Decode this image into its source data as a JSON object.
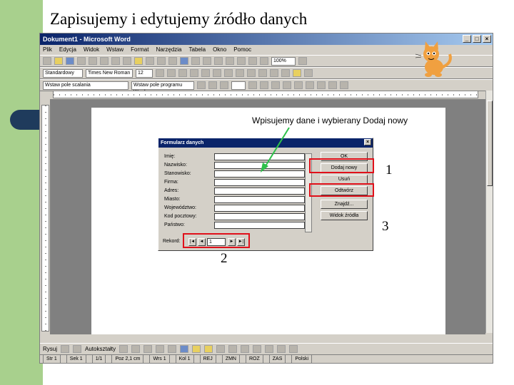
{
  "slide": {
    "title": "Zapisujemy i edytujemy źródło danych",
    "annotation": "Wpisujemy dane i wybierany Dodaj nowy",
    "markers": [
      "1",
      "2",
      "3"
    ]
  },
  "word": {
    "window_title": "Dokument1 - Microsoft Word",
    "menu": [
      "Plik",
      "Edycja",
      "Widok",
      "Wstaw",
      "Format",
      "Narzędzia",
      "Tabela",
      "Okno",
      "Pomoc"
    ],
    "style_combo": "Standardowy",
    "font_combo": "Times New Roman",
    "size_combo": "12",
    "zoom_combo": "100%",
    "mailmerge_combo": "Wstaw pole scalania",
    "word_field_combo": "Wstaw pole programu Word",
    "draw_label": "Rysuj",
    "autoshapes_label": "Autokształty",
    "status": [
      "Str 1",
      "Sek 1",
      "1/1",
      "Poz 2,1 cm",
      "Wrs 1",
      "Kol 1",
      "REJ",
      "ZMN",
      "ROZ",
      "ZAS",
      "Polski"
    ]
  },
  "dialog": {
    "title": "Formularz danych",
    "close_label": "×",
    "fields": [
      "Imię:",
      "Nazwisko:",
      "Stanowisko:",
      "Firma:",
      "Adres:",
      "Miasto:",
      "Województwo:",
      "Kod pocztowy:",
      "Państwo:"
    ],
    "buttons": [
      "OK",
      "Dodaj nowy",
      "Usuń",
      "Odtwórz",
      "Znajdź...",
      "Widok źródła"
    ],
    "record_label": "Rekord:",
    "record_value": "1",
    "nav": [
      "|◄",
      "◄",
      "►",
      "►|"
    ]
  }
}
